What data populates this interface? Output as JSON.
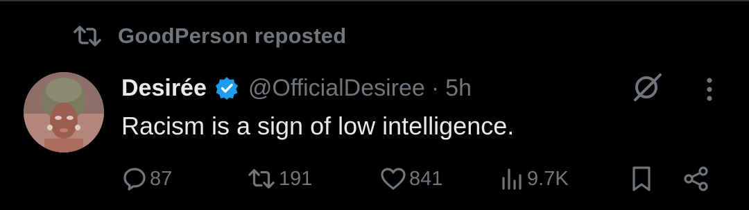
{
  "repost_banner": {
    "icon": "repost-icon",
    "text": "GoodPerson reposted"
  },
  "tweet": {
    "author": {
      "display_name": "Desirée",
      "verified_icon": "verified-badge-icon",
      "handle": "@OfficialDesiree",
      "separator": "·",
      "time": "5h"
    },
    "text": "Racism is a sign of low intelligence.",
    "actions": {
      "replies": "87",
      "reposts": "191",
      "likes": "841",
      "views": "9.7K"
    }
  },
  "icons": {
    "grok": "grok-icon",
    "more": "more-vertical-icon",
    "reply": "reply-icon",
    "repost": "repost-icon",
    "like": "heart-icon",
    "views": "views-chart-icon",
    "bookmark": "bookmark-icon",
    "share": "share-icon"
  },
  "colors": {
    "background": "#000000",
    "text_primary": "#e7e9ea",
    "text_secondary": "#71767b",
    "verified_blue": "#1d9bf0"
  }
}
